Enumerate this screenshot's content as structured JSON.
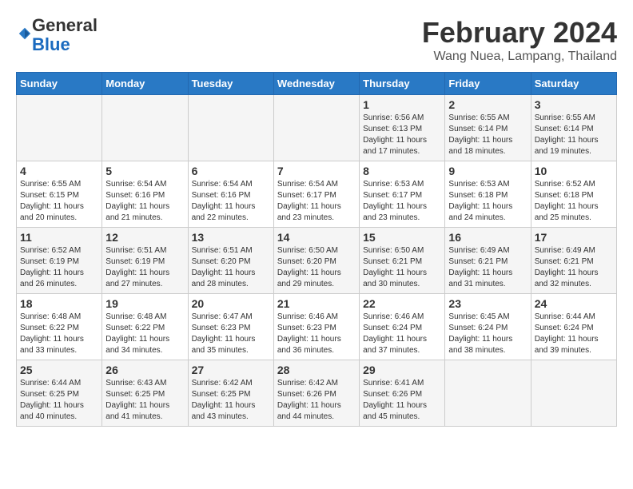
{
  "logo": {
    "general": "General",
    "blue": "Blue"
  },
  "header": {
    "title": "February 2024",
    "subtitle": "Wang Nuea, Lampang, Thailand"
  },
  "weekdays": [
    "Sunday",
    "Monday",
    "Tuesday",
    "Wednesday",
    "Thursday",
    "Friday",
    "Saturday"
  ],
  "weeks": [
    [
      {
        "day": "",
        "info": ""
      },
      {
        "day": "",
        "info": ""
      },
      {
        "day": "",
        "info": ""
      },
      {
        "day": "",
        "info": ""
      },
      {
        "day": "1",
        "info": "Sunrise: 6:56 AM\nSunset: 6:13 PM\nDaylight: 11 hours\nand 17 minutes."
      },
      {
        "day": "2",
        "info": "Sunrise: 6:55 AM\nSunset: 6:14 PM\nDaylight: 11 hours\nand 18 minutes."
      },
      {
        "day": "3",
        "info": "Sunrise: 6:55 AM\nSunset: 6:14 PM\nDaylight: 11 hours\nand 19 minutes."
      }
    ],
    [
      {
        "day": "4",
        "info": "Sunrise: 6:55 AM\nSunset: 6:15 PM\nDaylight: 11 hours\nand 20 minutes."
      },
      {
        "day": "5",
        "info": "Sunrise: 6:54 AM\nSunset: 6:16 PM\nDaylight: 11 hours\nand 21 minutes."
      },
      {
        "day": "6",
        "info": "Sunrise: 6:54 AM\nSunset: 6:16 PM\nDaylight: 11 hours\nand 22 minutes."
      },
      {
        "day": "7",
        "info": "Sunrise: 6:54 AM\nSunset: 6:17 PM\nDaylight: 11 hours\nand 23 minutes."
      },
      {
        "day": "8",
        "info": "Sunrise: 6:53 AM\nSunset: 6:17 PM\nDaylight: 11 hours\nand 23 minutes."
      },
      {
        "day": "9",
        "info": "Sunrise: 6:53 AM\nSunset: 6:18 PM\nDaylight: 11 hours\nand 24 minutes."
      },
      {
        "day": "10",
        "info": "Sunrise: 6:52 AM\nSunset: 6:18 PM\nDaylight: 11 hours\nand 25 minutes."
      }
    ],
    [
      {
        "day": "11",
        "info": "Sunrise: 6:52 AM\nSunset: 6:19 PM\nDaylight: 11 hours\nand 26 minutes."
      },
      {
        "day": "12",
        "info": "Sunrise: 6:51 AM\nSunset: 6:19 PM\nDaylight: 11 hours\nand 27 minutes."
      },
      {
        "day": "13",
        "info": "Sunrise: 6:51 AM\nSunset: 6:20 PM\nDaylight: 11 hours\nand 28 minutes."
      },
      {
        "day": "14",
        "info": "Sunrise: 6:50 AM\nSunset: 6:20 PM\nDaylight: 11 hours\nand 29 minutes."
      },
      {
        "day": "15",
        "info": "Sunrise: 6:50 AM\nSunset: 6:21 PM\nDaylight: 11 hours\nand 30 minutes."
      },
      {
        "day": "16",
        "info": "Sunrise: 6:49 AM\nSunset: 6:21 PM\nDaylight: 11 hours\nand 31 minutes."
      },
      {
        "day": "17",
        "info": "Sunrise: 6:49 AM\nSunset: 6:21 PM\nDaylight: 11 hours\nand 32 minutes."
      }
    ],
    [
      {
        "day": "18",
        "info": "Sunrise: 6:48 AM\nSunset: 6:22 PM\nDaylight: 11 hours\nand 33 minutes."
      },
      {
        "day": "19",
        "info": "Sunrise: 6:48 AM\nSunset: 6:22 PM\nDaylight: 11 hours\nand 34 minutes."
      },
      {
        "day": "20",
        "info": "Sunrise: 6:47 AM\nSunset: 6:23 PM\nDaylight: 11 hours\nand 35 minutes."
      },
      {
        "day": "21",
        "info": "Sunrise: 6:46 AM\nSunset: 6:23 PM\nDaylight: 11 hours\nand 36 minutes."
      },
      {
        "day": "22",
        "info": "Sunrise: 6:46 AM\nSunset: 6:24 PM\nDaylight: 11 hours\nand 37 minutes."
      },
      {
        "day": "23",
        "info": "Sunrise: 6:45 AM\nSunset: 6:24 PM\nDaylight: 11 hours\nand 38 minutes."
      },
      {
        "day": "24",
        "info": "Sunrise: 6:44 AM\nSunset: 6:24 PM\nDaylight: 11 hours\nand 39 minutes."
      }
    ],
    [
      {
        "day": "25",
        "info": "Sunrise: 6:44 AM\nSunset: 6:25 PM\nDaylight: 11 hours\nand 40 minutes."
      },
      {
        "day": "26",
        "info": "Sunrise: 6:43 AM\nSunset: 6:25 PM\nDaylight: 11 hours\nand 41 minutes."
      },
      {
        "day": "27",
        "info": "Sunrise: 6:42 AM\nSunset: 6:25 PM\nDaylight: 11 hours\nand 43 minutes."
      },
      {
        "day": "28",
        "info": "Sunrise: 6:42 AM\nSunset: 6:26 PM\nDaylight: 11 hours\nand 44 minutes."
      },
      {
        "day": "29",
        "info": "Sunrise: 6:41 AM\nSunset: 6:26 PM\nDaylight: 11 hours\nand 45 minutes."
      },
      {
        "day": "",
        "info": ""
      },
      {
        "day": "",
        "info": ""
      }
    ]
  ]
}
